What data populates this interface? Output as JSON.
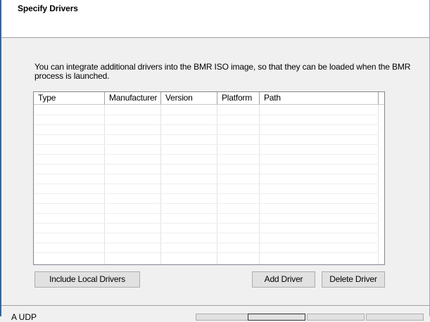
{
  "header": {
    "title": "Specify Drivers"
  },
  "description": {
    "line1": "You can integrate additional drivers into the BMR ISO image, so that they can be loaded when the BMR",
    "line2": "process is launched."
  },
  "grid": {
    "columns": [
      "Type",
      "Manufacturer",
      "Version",
      "Platform",
      "Path"
    ],
    "rows": []
  },
  "buttons": {
    "include_local": "Include Local Drivers",
    "add_driver": "Add Driver",
    "delete_driver": "Delete Driver"
  },
  "footer": {
    "text": "A         UDP"
  },
  "colors": {
    "window_border": "#2b67b3",
    "header_bg": "#ffffff",
    "body_bg": "#f0f0f0"
  }
}
